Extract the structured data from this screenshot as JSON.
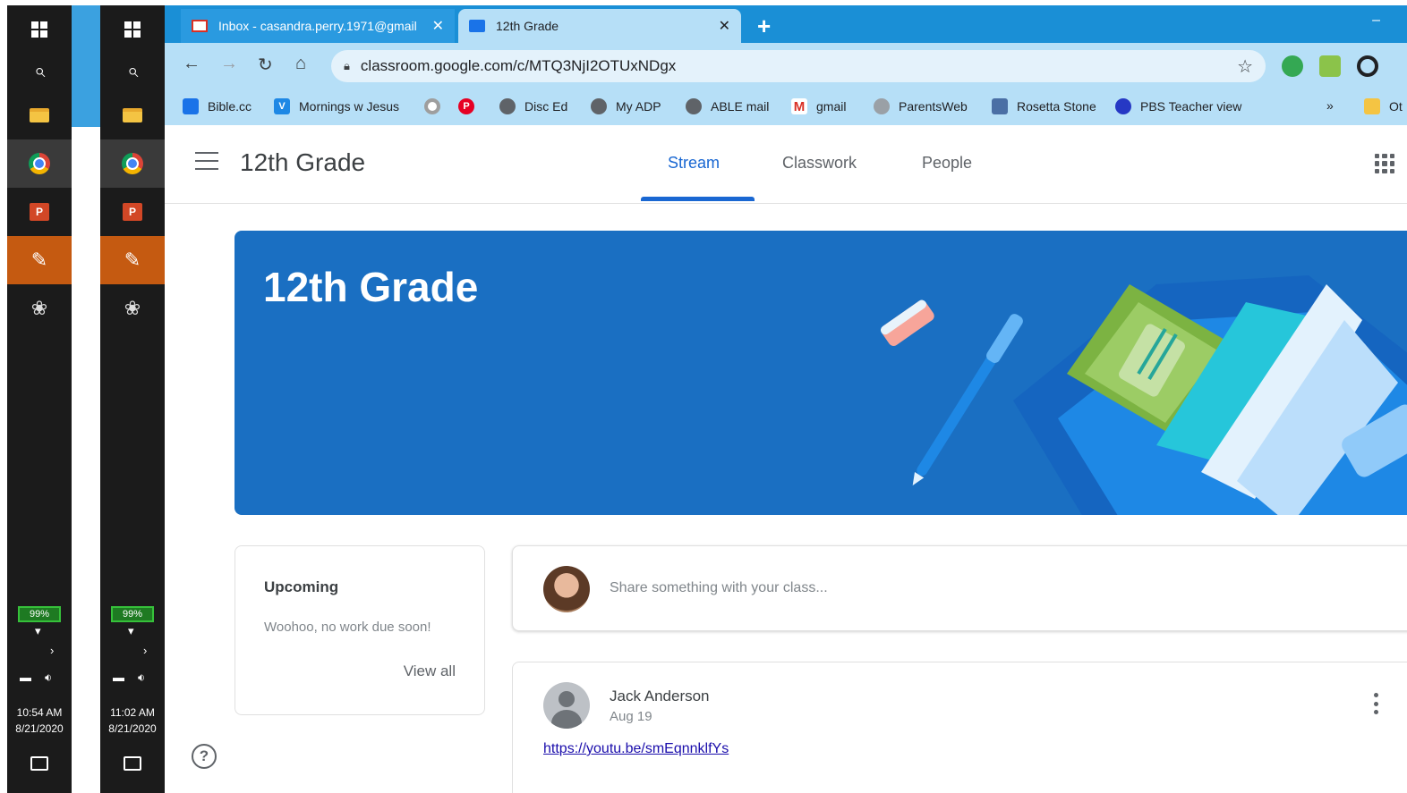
{
  "taskbar": {
    "battery": "99%",
    "clock1_time": "10:54 AM",
    "clock1_date": "8/21/2020",
    "clock2_time": "11:02 AM",
    "clock2_date": "8/21/2020"
  },
  "browser": {
    "tabs": [
      {
        "label": "Inbox - casandra.perry.1971@gmail"
      },
      {
        "label": "12th Grade"
      }
    ],
    "url": "classroom.google.com/c/MTQ3NjI2OTUxNDgx",
    "bookmarks": [
      {
        "label": "Bible.cc"
      },
      {
        "label": "Mornings w Jesus"
      },
      {
        "label": "Disc Ed"
      },
      {
        "label": "My ADP"
      },
      {
        "label": "ABLE mail"
      },
      {
        "label": "gmail"
      },
      {
        "label": "ParentsWeb"
      },
      {
        "label": "Rosetta Stone"
      },
      {
        "label": "PBS Teacher view"
      }
    ],
    "bookmarks_overflow": "Ot"
  },
  "classroom": {
    "class_name": "12th Grade",
    "nav_tabs": [
      {
        "label": "Stream"
      },
      {
        "label": "Classwork"
      },
      {
        "label": "People"
      }
    ],
    "banner_title": "12th Grade",
    "upcoming": {
      "title": "Upcoming",
      "message": "Woohoo, no work due soon!",
      "link": "View all"
    },
    "share_placeholder": "Share something with your class...",
    "post": {
      "author": "Jack Anderson",
      "date": "Aug 19",
      "link": "https://youtu.be/smEqnnklfYs"
    }
  },
  "colors": {
    "tabstrip": "#1a8fd6",
    "toolbar": "#b6dff7",
    "accent": "#1967d2",
    "banner": "#1a6fc2",
    "taskbar": "#1b1b1b"
  }
}
